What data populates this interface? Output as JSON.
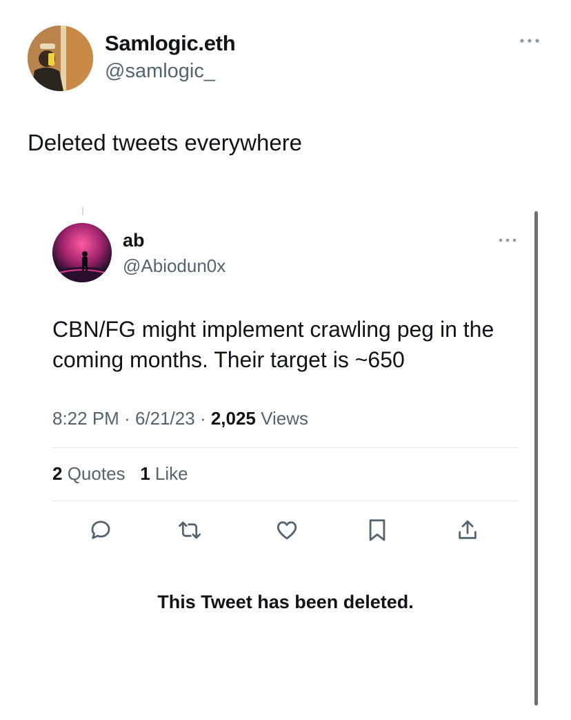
{
  "outer_tweet": {
    "display_name": "Samlogic.eth",
    "handle": "@samlogic_",
    "text": "Deleted tweets everywhere"
  },
  "quoted_tweet": {
    "display_name": "ab",
    "handle": "@Abiodun0x",
    "text": "CBN/FG might implement crawling peg in the coming months. Their target is ~650",
    "time": "8:22 PM",
    "date": "6/21/23",
    "views_count": "2,025",
    "views_label": "Views",
    "quotes_count": "2",
    "quotes_label": "Quotes",
    "likes_count": "1",
    "likes_label": "Like",
    "actions": [
      "reply-icon",
      "retweet-icon",
      "like-icon",
      "bookmark-icon",
      "share-icon"
    ]
  },
  "deleted_notice": "This Tweet has been deleted.",
  "colors": {
    "text_primary": "#0f1419",
    "text_secondary": "#536471",
    "divider": "#e1e5e8"
  }
}
